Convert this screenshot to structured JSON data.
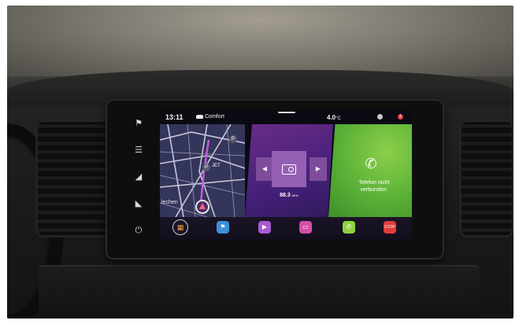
{
  "statusbar": {
    "time": "13:11",
    "profile_icon": "car-icon",
    "profile": "Comfort",
    "temperature": "4.0",
    "temperature_unit": "°C",
    "globe_icon": "globe-icon",
    "alert_icon": "alert-icon",
    "alert_count": "1"
  },
  "side_buttons": [
    {
      "icon": "flag-icon",
      "glyph": "⚑"
    },
    {
      "icon": "menu-icon",
      "glyph": "☰"
    },
    {
      "icon": "volume-up-icon",
      "glyph": "◢"
    },
    {
      "icon": "volume-down-icon",
      "glyph": "◣"
    },
    {
      "icon": "power-icon",
      "glyph": "⏻"
    }
  ],
  "map": {
    "city_label": "lechen",
    "poi_labels": [
      "JET",
      "P",
      "P"
    ]
  },
  "media": {
    "prev_glyph": "◀",
    "next_glyph": "▶",
    "frequency": "88.3",
    "frequency_unit": "MHz"
  },
  "phone": {
    "icon_glyph": "✆",
    "status_line1": "Telefon nicht",
    "status_line2": "verbunden."
  },
  "dock": {
    "home_glyph": "▦",
    "nav_glyph": "⚑",
    "media_glyph": "▶",
    "radio_glyph": "▭",
    "phone_glyph": "✆",
    "app_label": "STOP"
  }
}
